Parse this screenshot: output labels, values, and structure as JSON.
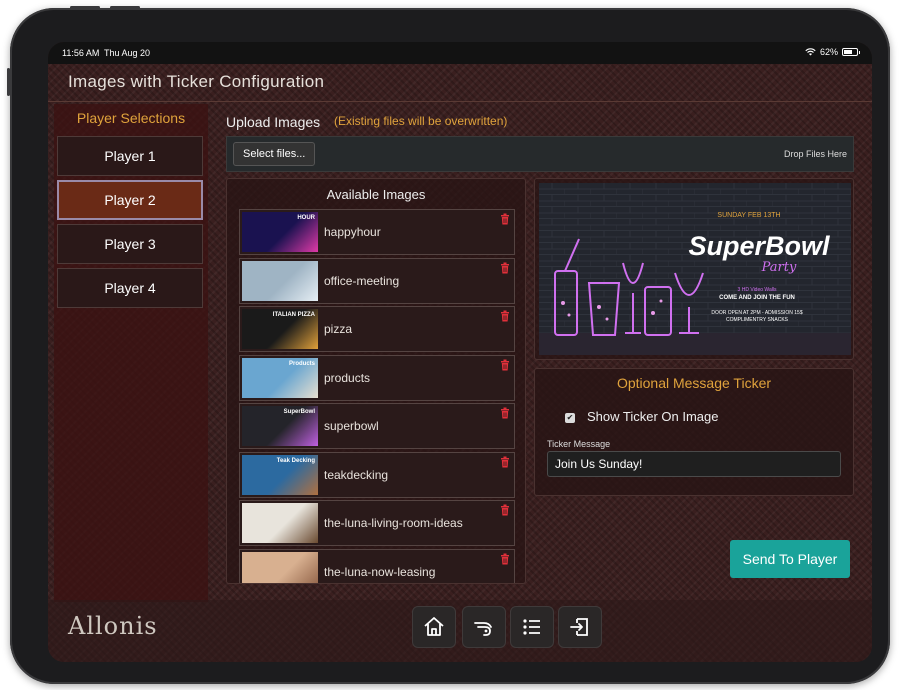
{
  "status_bar": {
    "time": "11:56 AM",
    "date": "Thu Aug 20",
    "battery": "62%"
  },
  "app": {
    "title": "Images with Ticker Configuration"
  },
  "sidebar": {
    "title": "Player Selections",
    "players": [
      {
        "label": "Player 1",
        "selected": false
      },
      {
        "label": "Player 2",
        "selected": true
      },
      {
        "label": "Player 3",
        "selected": false
      },
      {
        "label": "Player 4",
        "selected": false
      }
    ]
  },
  "upload": {
    "label": "Upload Images",
    "note": "(Existing files will be overwritten)",
    "select_button": "Select files...",
    "drop_text": "Drop Files Here"
  },
  "available": {
    "title": "Available Images",
    "items": [
      {
        "name": "happyhour",
        "thumb": "HOUR",
        "color": "#1a1250",
        "accent": "#e03aa8"
      },
      {
        "name": "office-meeting",
        "thumb": "",
        "color": "#9fb4c4",
        "accent": "#e6eef4"
      },
      {
        "name": "pizza",
        "thumb": "ITALIAN PIZZA",
        "color": "#1a1a1a",
        "accent": "#e0a03a"
      },
      {
        "name": "products",
        "thumb": "Products",
        "color": "#6aa6d0",
        "accent": "#e8e0d0"
      },
      {
        "name": "superbowl",
        "thumb": "SuperBowl",
        "color": "#24242a",
        "accent": "#c060e0"
      },
      {
        "name": "teakdecking",
        "thumb": "Teak Decking",
        "color": "#2c6aa0",
        "accent": "#b07040"
      },
      {
        "name": "the-luna-living-room-ideas",
        "thumb": "",
        "color": "#e8e4dc",
        "accent": "#6a4a30"
      },
      {
        "name": "the-luna-now-leasing",
        "thumb": "",
        "color": "#d8b090",
        "accent": "#8a5a40"
      }
    ]
  },
  "preview": {
    "date_text": "SUNDAY FEB 13TH",
    "title": "SuperBowl",
    "subtitle": "Party",
    "line1": "3 HD Video Walls",
    "line2": "COME AND JOIN THE FUN",
    "line3": "DOOR OPEN AT 2PM - ADMISSION 15$",
    "line4": "COMPLIMENTRY SNACKS"
  },
  "ticker": {
    "title": "Optional Message Ticker",
    "show_label": "Show Ticker On Image",
    "show_checked": true,
    "check_mark": "✔",
    "message_label": "Ticker Message",
    "message_value": "Join Us Sunday!"
  },
  "send_button": "Send To Player",
  "logo": "Allonis",
  "icons": {
    "home": "home-icon",
    "remote": "remote-pointer-icon",
    "list": "list-icon",
    "exit": "exit-icon"
  }
}
